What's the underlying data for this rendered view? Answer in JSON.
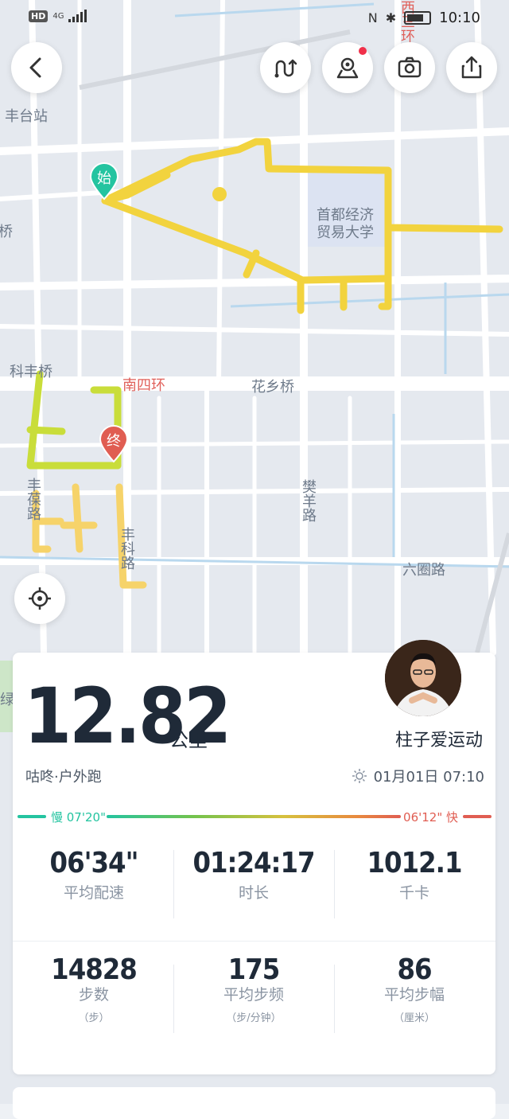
{
  "status_bar": {
    "hd": "HD",
    "network": "4G",
    "time": "10:10",
    "nfc": "N"
  },
  "map": {
    "labels": {
      "fengtai_station": "丰台站",
      "qiao": "桥",
      "university": "首都经济贸易大学",
      "university_1": "首都经济",
      "university_2": "贸易大学",
      "kefeng_bridge": "科丰桥",
      "south_4th_ring": "南四环",
      "huaxiang_bridge": "花乡桥",
      "fanyang_road": "樊羊路",
      "liuquan_road": "六圈路",
      "feng_road_left": "丰葆路",
      "feng_road_mid": "丰科路",
      "west_ring": "西三环",
      "west_ring2": "西三环",
      "bottom_left": "绿"
    },
    "markers": {
      "start": "始",
      "end": "终"
    },
    "route_color": "#f2d33e",
    "route_color_2": "#c9dd3a"
  },
  "summary": {
    "distance": "12.82",
    "unit": "公里",
    "username": "柱子爱运动",
    "activity_type": "咕咚·户外跑",
    "datetime": "01月01日 07:10",
    "pace_slow": "慢 07'20\"",
    "pace_fast": "06'12\" 快"
  },
  "stats": [
    {
      "value": "06'34\"",
      "label": "平均配速",
      "unit": ""
    },
    {
      "value": "01:24:17",
      "label": "时长",
      "unit": ""
    },
    {
      "value": "1012.1",
      "label": "千卡",
      "unit": ""
    },
    {
      "value": "14828",
      "label": "步数",
      "unit": "（步）"
    },
    {
      "value": "175",
      "label": "平均步频",
      "unit": "（步/分钟）"
    },
    {
      "value": "86",
      "label": "平均步幅",
      "unit": "（厘米）"
    }
  ],
  "colors": {
    "accent_slow": "#24c4a0",
    "accent_fast": "#e05d52",
    "text_dark": "#1f2a38"
  }
}
